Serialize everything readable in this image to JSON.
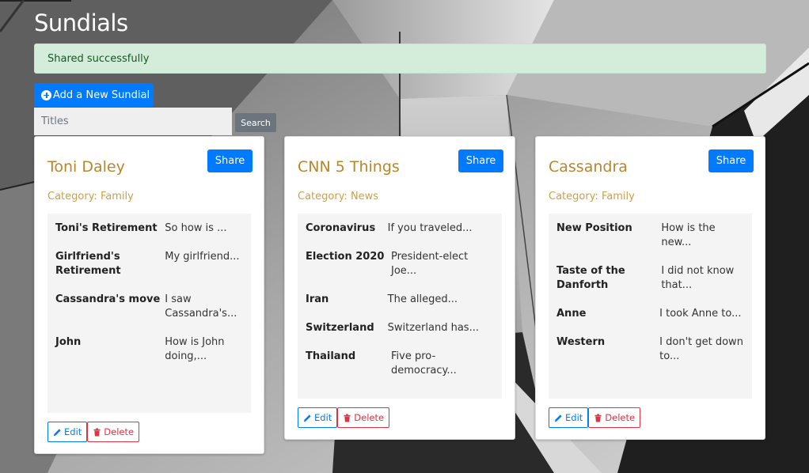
{
  "page": {
    "title": "Sundials"
  },
  "alert": {
    "text": "Shared successfully"
  },
  "toolbar": {
    "add_label": "Add a New Sundial",
    "search_placeholder": "Titles",
    "search_label": "Search"
  },
  "colors": {
    "primary": "#007bff",
    "title_gold": "#b8862b",
    "danger": "#dc3545",
    "alert_bg": "#d4edda"
  },
  "cards": [
    {
      "title": "Toni Daley",
      "category": "Category: Family",
      "share_label": "Share",
      "edit_label": "Edit",
      "delete_label": "Delete",
      "posts": [
        {
          "title": "Toni's Retirement",
          "snippet": "So how is ..."
        },
        {
          "title": "Girlfriend's Retirement",
          "snippet": "My girlfriend..."
        },
        {
          "title": "Cassandra's move",
          "snippet": "I saw Cassandra's..."
        },
        {
          "title": "John",
          "snippet": "How is John doing,..."
        }
      ]
    },
    {
      "title": "CNN 5 Things",
      "category": "Category: News",
      "share_label": "Share",
      "edit_label": "Edit",
      "delete_label": "Delete",
      "posts": [
        {
          "title": "Coronavirus",
          "snippet": "If you traveled..."
        },
        {
          "title": "Election 2020",
          "snippet": "President-elect Joe..."
        },
        {
          "title": "Iran",
          "snippet": "The alleged..."
        },
        {
          "title": "Switzerland",
          "snippet": "Switzerland has..."
        },
        {
          "title": "Thailand",
          "snippet": "Five pro-democracy..."
        }
      ]
    },
    {
      "title": "Cassandra",
      "category": "Category: Family",
      "share_label": "Share",
      "edit_label": "Edit",
      "delete_label": "Delete",
      "posts": [
        {
          "title": "New Position",
          "snippet": "How is the new..."
        },
        {
          "title": "Taste of the Danforth",
          "snippet": "I did not know that..."
        },
        {
          "title": "Anne",
          "snippet": "I took Anne to..."
        },
        {
          "title": "Western",
          "snippet": "I don't get down to..."
        }
      ]
    }
  ]
}
